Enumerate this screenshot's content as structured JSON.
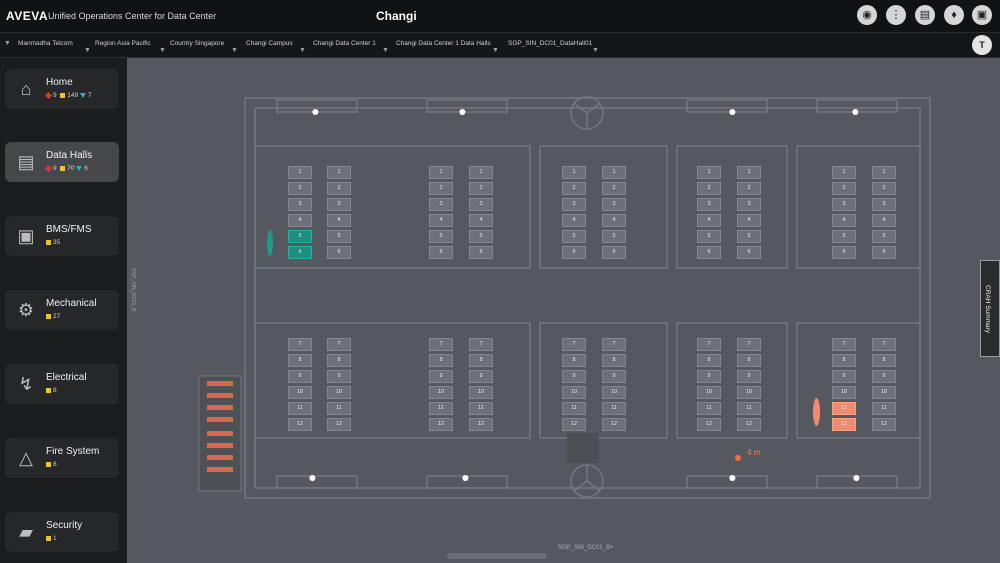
{
  "header": {
    "logo": "AVEVA",
    "app_title": "Unified Operations Center for Data Center",
    "page_title": "Changi",
    "icons": [
      "globe-icon",
      "network-icon",
      "document-icon",
      "bell-icon",
      "lock-icon"
    ]
  },
  "breadcrumb": {
    "items": [
      {
        "label": "Manmadha Telcom"
      },
      {
        "label": "Region Asia Pacific"
      },
      {
        "label": "Country Singapore"
      },
      {
        "label": "Changi Campus"
      },
      {
        "label": "Changi Data Center 1"
      },
      {
        "label": "Changi Data Center 1 Data Halls"
      },
      {
        "label": "SGP_SIN_DC01_DataHall01"
      }
    ],
    "user_initial": "T"
  },
  "sidebar": {
    "items": [
      {
        "label": "Home",
        "icon": "home-icon",
        "red": "9",
        "yellow": "149",
        "teal": "7",
        "active": false
      },
      {
        "label": "Data Halls",
        "icon": "server-icon",
        "red": "9",
        "yellow": "70",
        "teal": "6",
        "active": true
      },
      {
        "label": "BMS/FMS",
        "icon": "bms-icon",
        "yellow": "35",
        "active": false
      },
      {
        "label": "Mechanical",
        "icon": "mechanical-icon",
        "yellow": "27",
        "active": false
      },
      {
        "label": "Electrical",
        "icon": "electrical-icon",
        "yellow": "8",
        "active": false
      },
      {
        "label": "Fire System",
        "icon": "fire-icon",
        "yellow": "8",
        "active": false
      },
      {
        "label": "Security",
        "icon": "cctv-icon",
        "yellow": "1",
        "active": false
      }
    ]
  },
  "floorplan": {
    "top_rack_numbers": [
      "1",
      "2",
      "3",
      "4",
      "5",
      "6"
    ],
    "bottom_rack_numbers": [
      "7",
      "8",
      "9",
      "10",
      "11",
      "12"
    ],
    "measure_label": "4 m",
    "crah_tab": "CRAH Summary",
    "left_panel_label": "SGP_SIN_DC01_B",
    "bottom_tab": "SGP_SIN_DC01_B+"
  },
  "colors": {
    "alarm_green": "#1c8f82",
    "alarm_orange": "#f08a70",
    "accent_yellow": "#f2c31c",
    "accent_red": "#e0342f",
    "accent_teal": "#23b7c9"
  }
}
